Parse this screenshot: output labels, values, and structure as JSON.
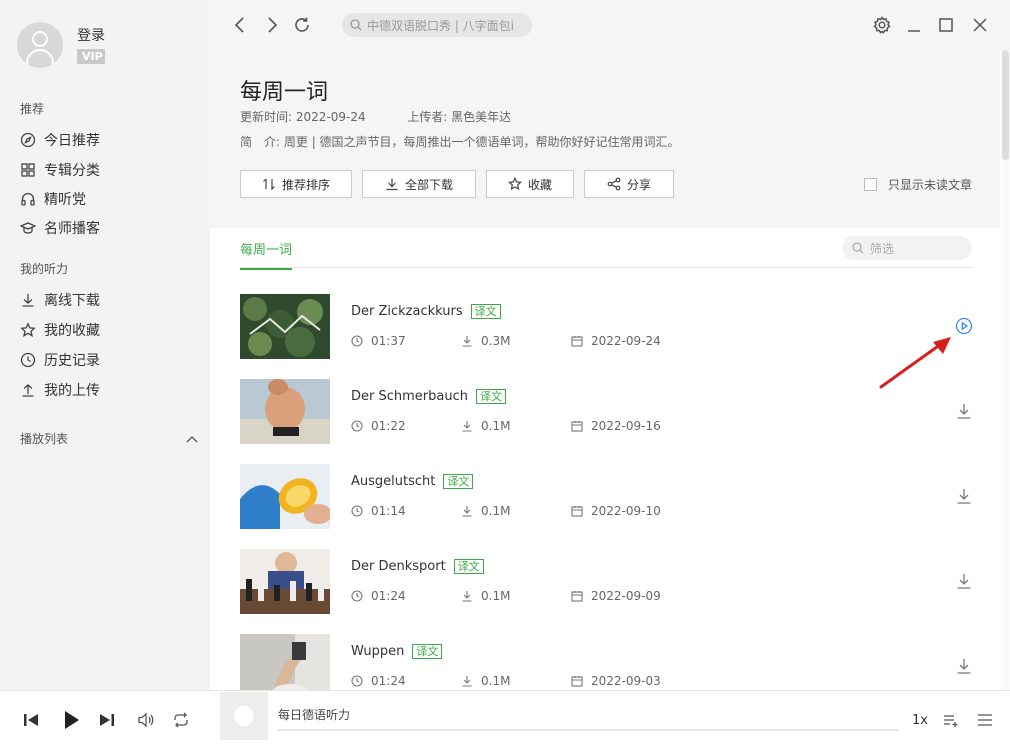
{
  "profile": {
    "login_label": "登录",
    "vip_label": "VIP"
  },
  "sidebar": {
    "section_recommend": "推荐",
    "recommend_items": [
      {
        "label": "今日推荐",
        "icon": "compass-icon"
      },
      {
        "label": "专辑分类",
        "icon": "grid-icon"
      },
      {
        "label": "精听党",
        "icon": "headphones-icon"
      },
      {
        "label": "名师播客",
        "icon": "graduation-cap-icon"
      }
    ],
    "section_my": "我的听力",
    "my_items": [
      {
        "label": "离线下载",
        "icon": "download-icon"
      },
      {
        "label": "我的收藏",
        "icon": "star-icon"
      },
      {
        "label": "历史记录",
        "icon": "clock-icon"
      },
      {
        "label": "我的上传",
        "icon": "upload-icon"
      }
    ],
    "playlist_label": "播放列表"
  },
  "topbar": {
    "search_placeholder": "中德双语脱口秀 | 八字面包i"
  },
  "album": {
    "title": "每周一词",
    "update_label": "更新时间:",
    "update_date": "2022-09-24",
    "uploader_label": "上传者:",
    "uploader": "黑色美年达",
    "intro_label": "简　介:",
    "intro": "周更 | 德国之声节目，每周推出一个德语单词，帮助你好好记住常用词汇。",
    "buttons": {
      "sort": "推荐排序",
      "download_all": "全部下载",
      "favorite": "收藏",
      "share": "分享"
    },
    "only_unread": "只显示未读文章"
  },
  "tabs": {
    "active": "每周一词",
    "filter_placeholder": "筛选"
  },
  "items": [
    {
      "title": "Der Zickzackkurs",
      "badge": "译文",
      "duration": "01:37",
      "size": "0.3M",
      "date": "2022-09-24",
      "action": "play"
    },
    {
      "title": "Der Schmerbauch",
      "badge": "译文",
      "duration": "01:22",
      "size": "0.1M",
      "date": "2022-09-16",
      "action": "download"
    },
    {
      "title": "Ausgelutscht",
      "badge": "译文",
      "duration": "01:14",
      "size": "0.1M",
      "date": "2022-09-10",
      "action": "download"
    },
    {
      "title": "Der Denksport",
      "badge": "译文",
      "duration": "01:24",
      "size": "0.1M",
      "date": "2022-09-09",
      "action": "download"
    },
    {
      "title": "Wuppen",
      "badge": "译文",
      "duration": "01:24",
      "size": "0.1M",
      "date": "2022-09-03",
      "action": "download"
    }
  ],
  "player": {
    "now_playing": "每日德语听力",
    "speed": "1x"
  },
  "colors": {
    "accent": "#3bab47",
    "play_blue": "#3a8ee6",
    "arrow_red": "#d42020"
  }
}
